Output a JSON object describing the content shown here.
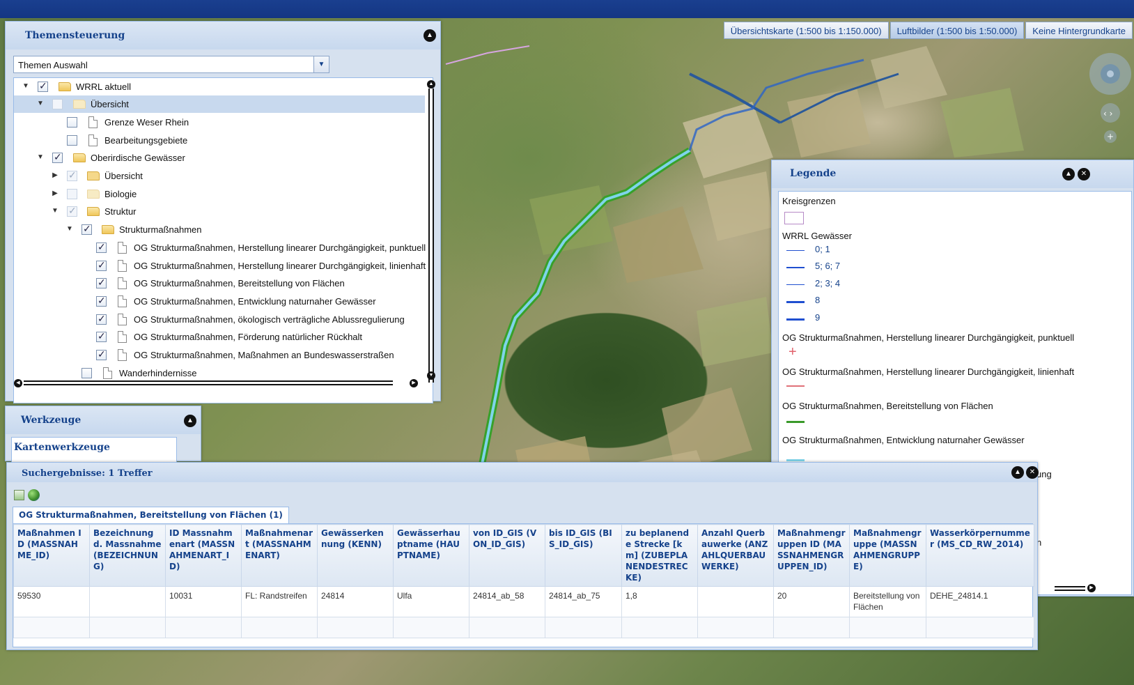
{
  "basemap_buttons": [
    {
      "label": "Übersichtskarte (1:500 bis 1:150.000)",
      "active": false
    },
    {
      "label": "Luftbilder (1:500 bis 1:50.000)",
      "active": true
    },
    {
      "label": "Keine Hintergrundkarte",
      "active": false
    }
  ],
  "themensteuerung": {
    "title": "Themensteuerung",
    "combo_value": "Themen Auswahl",
    "tree": [
      {
        "label": "WRRL aktuell"
      },
      {
        "label": "Übersicht"
      },
      {
        "label": "Grenze Weser Rhein"
      },
      {
        "label": "Bearbeitungsgebiete"
      },
      {
        "label": "Oberirdische Gewässer"
      },
      {
        "label": "Übersicht"
      },
      {
        "label": "Biologie"
      },
      {
        "label": "Struktur"
      },
      {
        "label": "Strukturmaßnahmen"
      },
      {
        "label": "OG Strukturmaßnahmen, Herstellung linearer Durchgängigkeit, punktuell"
      },
      {
        "label": "OG Strukturmaßnahmen, Herstellung linearer Durchgängigkeit, linienhaft"
      },
      {
        "label": "OG Strukturmaßnahmen, Bereitstellung von Flächen"
      },
      {
        "label": "OG Strukturmaßnahmen, Entwicklung naturnaher Gewässer"
      },
      {
        "label": "OG Strukturmaßnahmen, ökologisch verträgliche Ablussregulierung"
      },
      {
        "label": "OG Strukturmaßnahmen, Förderung natürlicher Rückhalt"
      },
      {
        "label": "OG Strukturmaßnahmen, Maßnahmen an Bundeswasserstraßen"
      },
      {
        "label": "Wanderhindernisse"
      }
    ]
  },
  "werkzeuge": {
    "title": "Werkzeuge",
    "section": "Kartenwerkzeuge"
  },
  "legende": {
    "title": "Legende",
    "kreisgrenzen": "Kreisgrenzen",
    "wrrl": "WRRL Gewässer",
    "wrrl_classes": [
      "0; 1",
      "5; 6; 7",
      "2; 3; 4",
      "8",
      "9"
    ],
    "layers": [
      "OG Strukturmaßnahmen, Herstellung linearer Durchgängigkeit, punktuell",
      "OG Strukturmaßnahmen, Herstellung linearer Durchgängigkeit, linienhaft",
      "OG Strukturmaßnahmen, Bereitstellung von Flächen",
      "OG Strukturmaßnahmen, Entwicklung naturnaher Gewässer"
    ],
    "partial_text_1": "ung",
    "partial_text_2": "n",
    "colors": {
      "plus": "#e0606a",
      "linienhaft": "#e07078",
      "flaechen": "#3a9a2a",
      "naturnah": "#7fd4ea",
      "wrrl": "#1f4fd0"
    }
  },
  "suche": {
    "title": "Suchergebnisse: 1 Treffer",
    "tab": "OG Strukturmaßnahmen, Bereitstellung von Flächen (1)",
    "columns": [
      "Maßnahmen ID (MASSNAHME_ID)",
      "Bezeichnung d. Massnahme (BEZEICHNUNG)",
      "ID Massnahmenart (MASSNAHMENART_ID)",
      "Maßnahmenart (MASSNAHMENART)",
      "Gewässerkennung (KENN)",
      "Gewässerhauptname (HAUPTNAME)",
      "von ID_GIS (VON_ID_GIS)",
      "bis ID_GIS (BIS_ID_GIS)",
      "zu beplanende Strecke [km] (ZUBEPLANENDESTRECKE)",
      "Anzahl Querbauwerke (ANZAHLQUERBAUWERKE)",
      "Maßnahmengruppen ID (MASSNAHMENGRUPPEN_ID)",
      "Maßnahmengruppe (MASSNAHMENGRUPPE)",
      "Wasserkörpernummer (MS_CD_RW_2014)"
    ],
    "rows": [
      [
        "59530",
        "",
        "10031",
        "FL: Randstreifen",
        "24814",
        "Ulfa",
        "24814_ab_58",
        "24814_ab_75",
        "1,8",
        "",
        "20",
        "Bereitstellung von Flächen",
        "DEHE_24814.1"
      ]
    ]
  }
}
